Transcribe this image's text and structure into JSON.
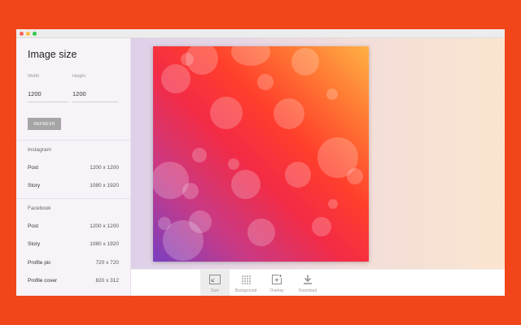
{
  "sidebar": {
    "title": "Image size",
    "width_label": "Width",
    "height_label": "Height",
    "width_value": "1200",
    "height_value": "1200",
    "refresh_label": "REFRESH",
    "groups": [
      {
        "name": "Instagram",
        "presets": [
          {
            "name": "Post",
            "size": "1200 x 1200"
          },
          {
            "name": "Story",
            "size": "1080 x 1920"
          }
        ]
      },
      {
        "name": "Facebook",
        "presets": [
          {
            "name": "Post",
            "size": "1200 x 1200"
          },
          {
            "name": "Story",
            "size": "1080 x 1920"
          },
          {
            "name": "Profile pic",
            "size": "720 x 720"
          },
          {
            "name": "Profile cover",
            "size": "820 x 312"
          }
        ]
      }
    ]
  },
  "toolbar": {
    "items": [
      {
        "label": "Size",
        "icon": "resize-icon",
        "active": true
      },
      {
        "label": "Background",
        "icon": "dot-grid-icon",
        "active": false
      },
      {
        "label": "Overlay",
        "icon": "add-overlay-icon",
        "active": false
      },
      {
        "label": "Download",
        "icon": "download-icon",
        "active": false
      }
    ]
  },
  "colors": {
    "page_background": "#f0461a",
    "gradient_start": "#7a3fc0",
    "gradient_mid": "#ff3f2c",
    "gradient_end": "#ffb145"
  }
}
